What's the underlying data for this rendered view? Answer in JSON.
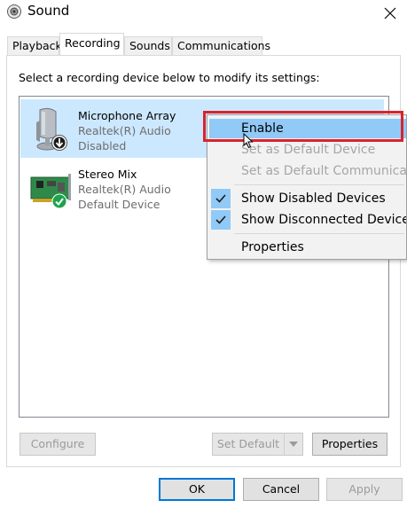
{
  "window": {
    "title": "Sound",
    "icon": "speaker-icon",
    "close": "close-icon"
  },
  "tabs": [
    {
      "label": "Playback",
      "active": false
    },
    {
      "label": "Recording",
      "active": true
    },
    {
      "label": "Sounds",
      "active": false
    },
    {
      "label": "Communications",
      "active": false
    }
  ],
  "instruction": "Select a recording device below to modify its settings:",
  "devices": [
    {
      "name": "Microphone Array",
      "driver": "Realtek(R) Audio",
      "status": "Disabled",
      "icon": "microphone-icon",
      "badge": "down-arrow-badge-icon",
      "selected": true
    },
    {
      "name": "Stereo Mix",
      "driver": "Realtek(R) Audio",
      "status": "Default Device",
      "icon": "sound-card-icon",
      "badge": "green-check-badge-icon",
      "selected": false
    }
  ],
  "context_menu": {
    "items": [
      {
        "label": "Enable",
        "enabled": true,
        "hovered": true,
        "checked": false
      },
      {
        "label": "Set as Default Device",
        "enabled": false,
        "checked": false
      },
      {
        "label": "Set as Default Communication Device",
        "enabled": false,
        "checked": false
      },
      {
        "label": "Show Disabled Devices",
        "enabled": true,
        "checked": true
      },
      {
        "label": "Show Disconnected Devices",
        "enabled": true,
        "checked": true
      },
      {
        "label": "Properties",
        "enabled": true,
        "checked": false
      }
    ]
  },
  "panel_buttons": {
    "configure": "Configure",
    "set_default": "Set Default",
    "properties": "Properties"
  },
  "dialog_buttons": {
    "ok": "OK",
    "cancel": "Cancel",
    "apply": "Apply"
  },
  "colors": {
    "selection": "#cce8ff",
    "menu_hover": "#91c9f7",
    "highlight_border": "#d9232e",
    "focus_border": "#0078d7"
  }
}
